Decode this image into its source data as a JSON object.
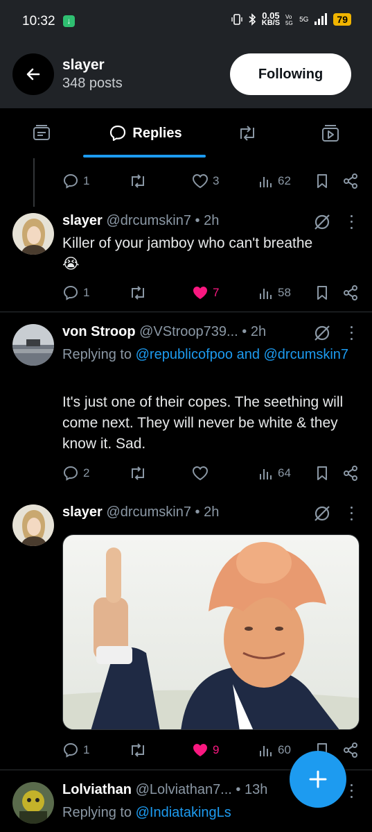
{
  "status_bar": {
    "time": "10:32",
    "speed_value": "0.05",
    "speed_unit": "KB/S",
    "network": "5G",
    "battery": "79"
  },
  "header": {
    "name": "slayer",
    "posts": "348 posts",
    "follow_label": "Following"
  },
  "tabs": [
    {
      "name": "posts",
      "icon": "article-icon"
    },
    {
      "name": "replies",
      "label": "Replies",
      "icon": "reply-bubble-icon",
      "active": true
    },
    {
      "name": "reposts",
      "icon": "repost-icon"
    },
    {
      "name": "media",
      "icon": "media-icon"
    }
  ],
  "posts": [
    {
      "id": "partial",
      "actions": {
        "replies": "1",
        "reposts": "",
        "likes": "3",
        "liked": false,
        "views": "62"
      }
    },
    {
      "id": "p1",
      "author": "slayer",
      "handle": "@drcumskin7",
      "time": "• 2h",
      "text": "Killer of your jamboy who can't breathe",
      "emoji": "😭",
      "actions": {
        "replies": "1",
        "reposts": "",
        "likes": "7",
        "liked": true,
        "views": "58"
      }
    },
    {
      "id": "p2",
      "author": "von Stroop",
      "handle": "@VStroop739...",
      "time": "• 2h",
      "replying_prefix": "Replying to ",
      "replying_to": "@republicofpoo and @drcumskin7",
      "text": "It's just one of their copes. The seething will come next. They will never be white & they know it. Sad.",
      "actions": {
        "replies": "2",
        "reposts": "",
        "likes": "",
        "liked": false,
        "views": "64"
      }
    },
    {
      "id": "p3",
      "author": "slayer",
      "handle": "@drcumskin7",
      "time": "• 2h",
      "actions": {
        "replies": "1",
        "reposts": "",
        "likes": "9",
        "liked": true,
        "views": "60"
      }
    },
    {
      "id": "p4",
      "author": "Lolviathan",
      "handle": "@Lolviathan7...",
      "time": "• 13h",
      "replying_prefix": "Replying to ",
      "replying_to": "@IndiatakingLs"
    }
  ],
  "colors": {
    "accent": "#1d9bf0",
    "like": "#f91880",
    "muted_text": "#8b98a5",
    "header_bg": "#202327"
  }
}
